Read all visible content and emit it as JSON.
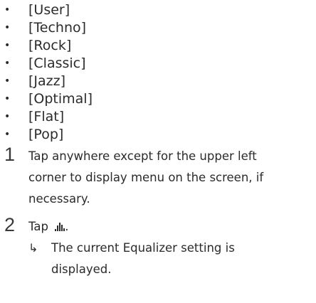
{
  "bullets": [
    "[User]",
    "[Techno]",
    "[Rock]",
    "[Classic]",
    "[Jazz]",
    "[Optimal]",
    "[Flat]",
    "[Pop]"
  ],
  "steps": [
    {
      "number": "1",
      "lines": [
        "Tap anywhere except for the upper left",
        "corner to display menu on the screen, if",
        "necessary."
      ]
    },
    {
      "number": "2",
      "prefix": "Tap",
      "suffix": ".",
      "icon": "equalizer-icon",
      "result": {
        "arrow": "↳",
        "lines": [
          "The current Equalizer setting is",
          "displayed."
        ]
      }
    }
  ]
}
